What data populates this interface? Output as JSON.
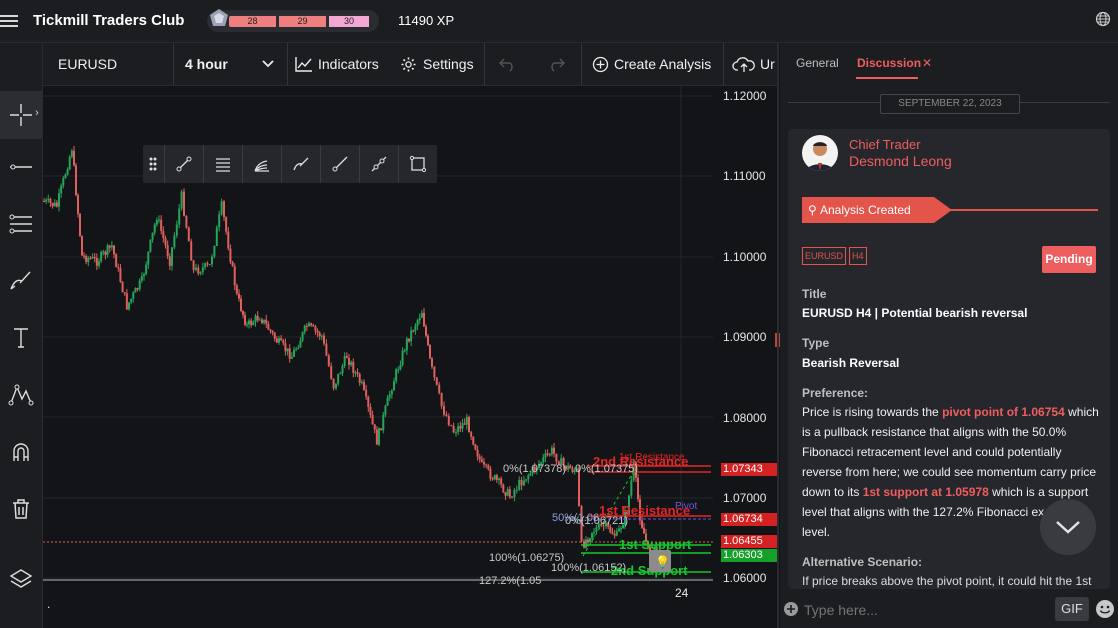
{
  "app": {
    "title": "Tickmill Traders Club",
    "xp_levels": [
      "28",
      "29",
      "30"
    ],
    "xp": "11490 XP"
  },
  "toolbar": {
    "symbol": "EURUSD",
    "timeframe": "4 hour",
    "indicators_label": "Indicators",
    "settings_label": "Settings",
    "create_analysis_label": "Create Analysis",
    "upload_label": "Ur"
  },
  "chart": {
    "price_labels": [
      "1.12000",
      "1.11000",
      "1.10000",
      "1.09000",
      "1.08000",
      "1.07000",
      "1.06000"
    ],
    "price_tags": [
      {
        "text": "1.07343",
        "color": "#d42121"
      },
      {
        "text": "1.06734",
        "color": "#d42121"
      },
      {
        "text": "1.06455",
        "color": "#d42121"
      },
      {
        "text": "1.06303",
        "color": "#16a02a"
      }
    ],
    "x_label": "24",
    "x_dot": ".",
    "annotations": {
      "resistance2": "2nd Resistance",
      "resistance1_small": "1st Resistance",
      "resistance1": "1st Resistance",
      "pivot": "Pivot",
      "support1": "1st Support",
      "support2": "2nd Support",
      "fib_top": "0%(1.07378)",
      "fib_top2": "0%(1.07375)",
      "fib_50": "50%(1.06",
      "fib_50b": "0%(1.06721)",
      "fib_100": "100%(1.06275)",
      "fib_100b": "100%(1.06152)",
      "fib_1272": "127.2%(1.05"
    }
  },
  "panel": {
    "tabs": [
      "General",
      "Discussion"
    ],
    "date": "SEPTEMBER 22, 2023",
    "author_role": "Chief Trader",
    "author_name": "Desmond Leong",
    "status_bar": "Analysis Created",
    "tags": [
      "EURUSD",
      "H4"
    ],
    "pending": "Pending",
    "title_label": "Title",
    "title_value": "EURUSD H4 | Potential bearish reversal",
    "type_label": "Type",
    "type_value": "Bearish Reversal",
    "preference_label": "Preference:",
    "preference_text": {
      "p1": "Price is rising towards the ",
      "p2": "pivot point of 1.06754",
      "p3": " which is a pullback resistance that aligns with the 50.0% Fibonacci retracement level and could potentially reverse from here; we could see momentum carry price down to its ",
      "p4": "1st support at 1.05978",
      "p5": " which is a support level that aligns with the 127.2% Fibonacci ex",
      "p6": "level."
    },
    "alt_label": "Alternative Scenario:",
    "alt_text": "If price breaks above the pivot point, it could hit the 1st",
    "input_placeholder": "Type here...",
    "gif_label": "GIF"
  },
  "colors": {
    "accent": "#ef5e5e",
    "green": "#16c72c",
    "red": "#e32626"
  }
}
